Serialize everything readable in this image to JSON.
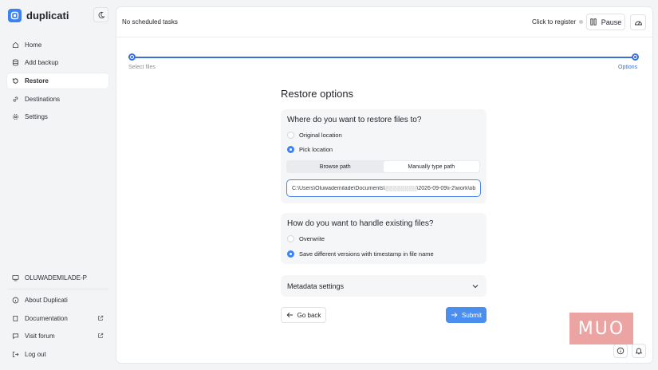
{
  "app": {
    "name": "duplicati"
  },
  "sidebar": {
    "items": [
      {
        "label": "Home",
        "icon": "home-icon"
      },
      {
        "label": "Add backup",
        "icon": "database-icon"
      },
      {
        "label": "Restore",
        "icon": "restore-icon",
        "active": true
      },
      {
        "label": "Destinations",
        "icon": "link-icon"
      },
      {
        "label": "Settings",
        "icon": "gear-icon"
      }
    ],
    "machine": "OLUWADEMILADE-P",
    "footer": [
      {
        "label": "About Duplicati",
        "icon": "info-icon"
      },
      {
        "label": "Documentation",
        "icon": "book-icon"
      },
      {
        "label": "Visit forum",
        "icon": "forum-icon"
      },
      {
        "label": "Log out",
        "icon": "logout-icon"
      }
    ]
  },
  "topbar": {
    "status": "No scheduled tasks",
    "register": "Click to register",
    "pause": "Pause"
  },
  "stepper": {
    "start": "Select files",
    "end": "Options"
  },
  "restore": {
    "title": "Restore options",
    "location": {
      "question": "Where do you want to restore files to?",
      "options": [
        "Original location",
        "Pick location"
      ],
      "selected": "Pick location",
      "tabs": [
        "Browse path",
        "Manually type path"
      ],
      "active_tab": "Manually type path",
      "path": "C:\\Users\\Oluwademilade\\Documents\\░░░░░░░░\\2026-09-09\\i-2\\work\\ob"
    },
    "existing": {
      "question": "How do you want to handle existing files?",
      "options": [
        "Overwrite",
        "Save different versions with timestamp in file name"
      ],
      "selected": "Save different versions with timestamp in file name"
    },
    "metadata": "Metadata settings",
    "back": "Go back",
    "submit": "Submit"
  },
  "watermark": "MUO",
  "colors": {
    "accent": "#3b82f6",
    "primary_button": "#4a8ff0",
    "stepper": "#3b6fd8"
  }
}
